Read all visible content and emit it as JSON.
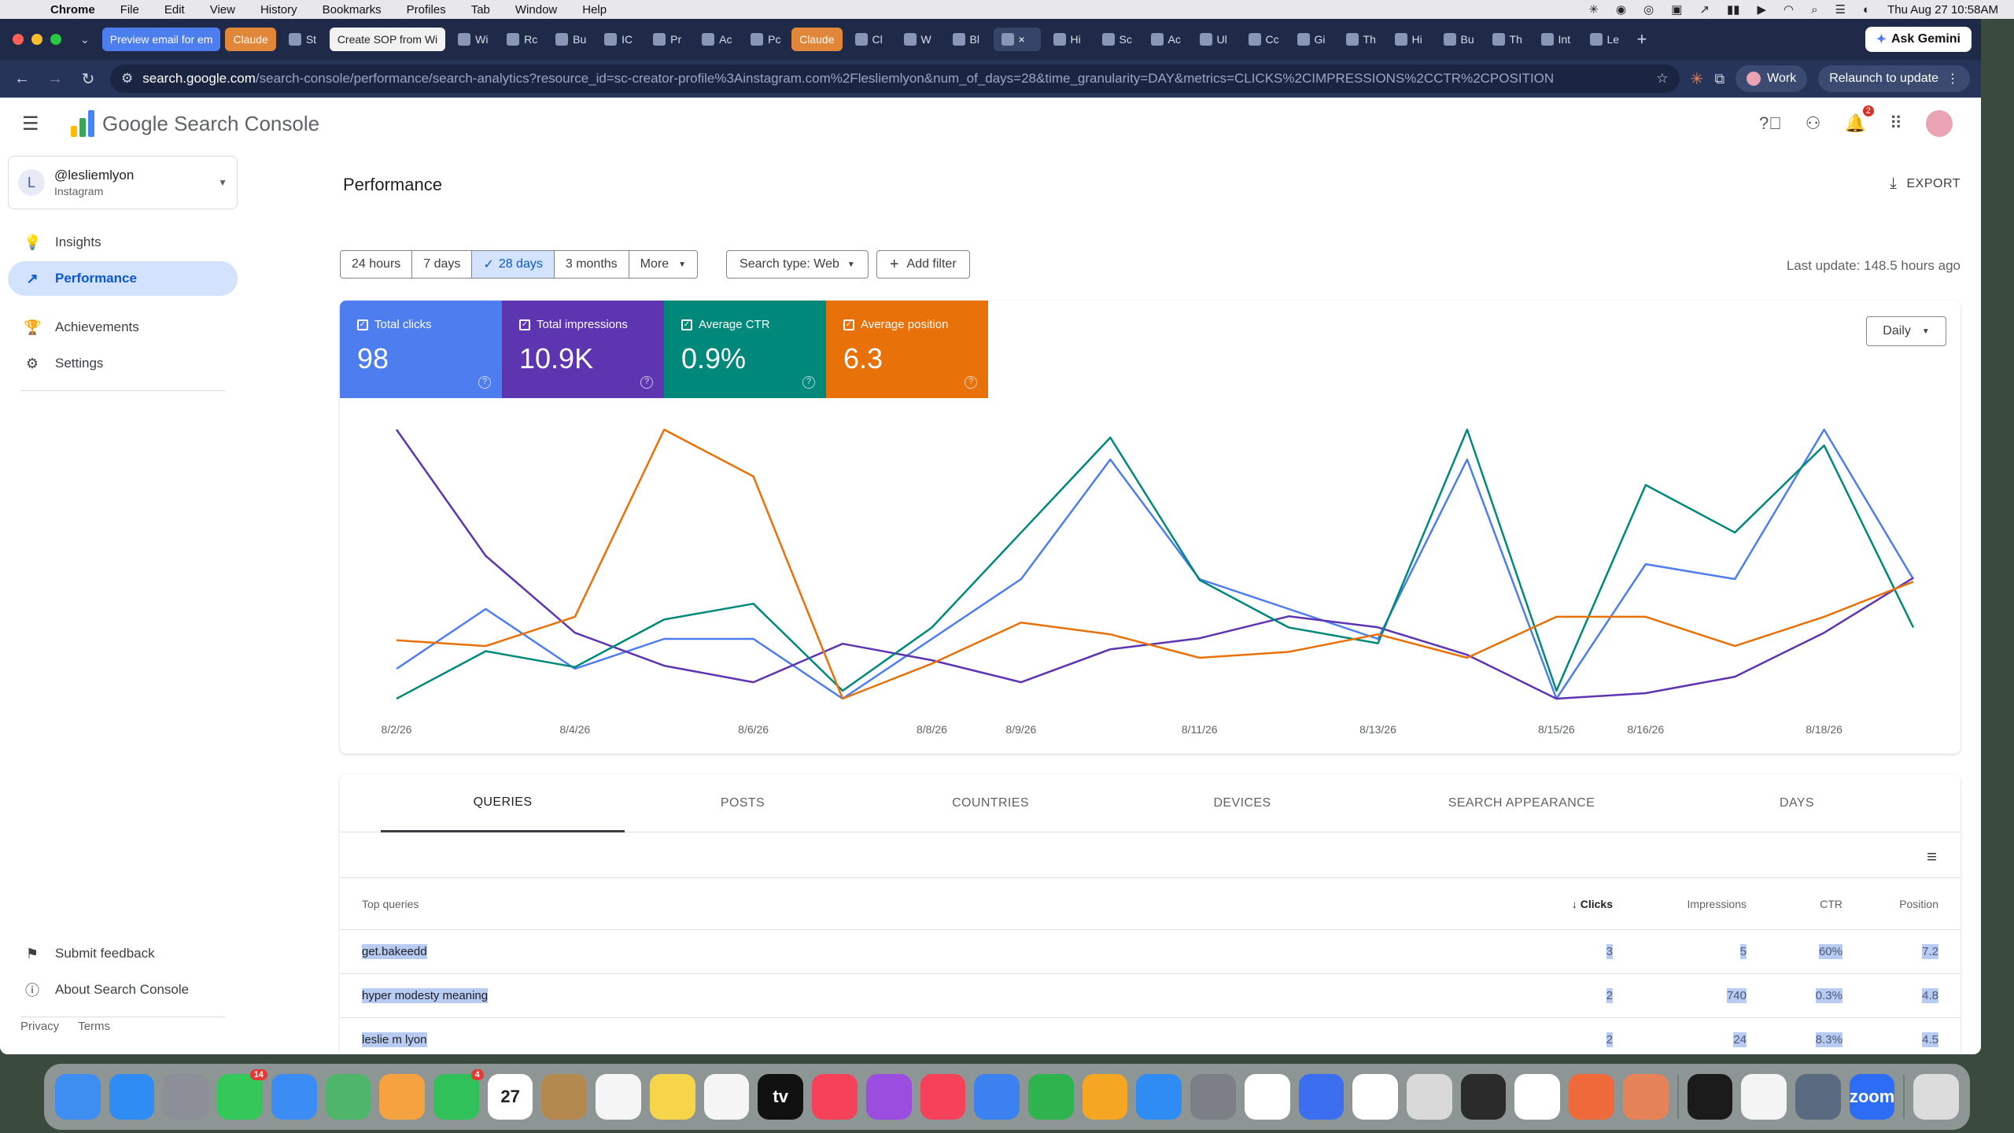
{
  "menubar": {
    "app": "Chrome",
    "items": [
      "File",
      "Edit",
      "View",
      "History",
      "Bookmarks",
      "Profiles",
      "Tab",
      "Window",
      "Help"
    ],
    "datetime": "Thu Aug 27  10:58AM"
  },
  "browser": {
    "tabs": [
      {
        "label": "Preview email for em",
        "style": "chip-blue"
      },
      {
        "label": "Claude",
        "style": "chip-orange"
      },
      {
        "label": "St",
        "style": "compact"
      },
      {
        "label": "Create SOP from Wi",
        "style": "chip-white"
      },
      {
        "label": "Wi",
        "style": "compact"
      },
      {
        "label": "Rc",
        "style": "compact"
      },
      {
        "label": "Bu",
        "style": "compact"
      },
      {
        "label": "IC",
        "style": "compact"
      },
      {
        "label": "Pr",
        "style": "compact"
      },
      {
        "label": "Ac",
        "style": "compact"
      },
      {
        "label": "Pc",
        "style": "compact"
      },
      {
        "label": "Claude",
        "style": "chip-orange"
      },
      {
        "label": "Cl",
        "style": "compact"
      },
      {
        "label": "W",
        "style": "compact"
      },
      {
        "label": "Bl",
        "style": "compact"
      },
      {
        "label": "×",
        "style": "active"
      },
      {
        "label": "Hi",
        "style": "compact"
      },
      {
        "label": "Sc",
        "style": "compact"
      },
      {
        "label": "Ac",
        "style": "compact"
      },
      {
        "label": "Ul",
        "style": "compact"
      },
      {
        "label": "Cc",
        "style": "compact"
      },
      {
        "label": "Gi",
        "style": "compact"
      },
      {
        "label": "Th",
        "style": "compact"
      },
      {
        "label": "Hi",
        "style": "compact"
      },
      {
        "label": "Bu",
        "style": "compact"
      },
      {
        "label": "Th",
        "style": "compact"
      },
      {
        "label": "Int",
        "style": "compact"
      },
      {
        "label": "Le",
        "style": "compact"
      }
    ],
    "new_tab": "+",
    "ask_gemini": "Ask Gemini",
    "url_host": "search.google.com",
    "url_path": "/search-console/performance/search-analytics?resource_id=sc-creator-profile%3Ainstagram.com%2Flesliemlyon&num_of_days=28&time_granularity=DAY&metrics=CLICKS%2CIMPRESSIONS%2CCTR%2CPOSITION",
    "profile_chip": "Work",
    "relaunch": "Relaunch to update"
  },
  "gsc": {
    "product_name": "Google Search Console",
    "property": {
      "initial": "L",
      "name": "@lesliemlyon",
      "type": "Instagram"
    },
    "nav": [
      {
        "label": "Insights",
        "icon": "lightbulb-icon",
        "glyph": "💡"
      },
      {
        "label": "Performance",
        "icon": "trending-up-icon",
        "glyph": "↗"
      },
      {
        "label": "Achievements",
        "icon": "trophy-icon",
        "glyph": "🏆"
      },
      {
        "label": "Settings",
        "icon": "gear-icon",
        "glyph": "⚙"
      }
    ],
    "bottom_nav": [
      {
        "label": "Submit feedback",
        "icon": "feedback-icon",
        "glyph": "⚑"
      },
      {
        "label": "About Search Console",
        "icon": "info-icon",
        "glyph": "ⓘ"
      }
    ],
    "footer": {
      "privacy": "Privacy",
      "terms": "Terms"
    },
    "notification_count": "2"
  },
  "performance": {
    "title": "Performance",
    "export": "EXPORT",
    "date_ranges": [
      "24 hours",
      "7 days",
      "28 days",
      "3 months",
      "More"
    ],
    "selected_range": "28 days",
    "search_type": "Search type: Web",
    "add_filter": "Add filter",
    "last_update": "Last update: 148.5 hours ago",
    "granularity": "Daily",
    "metrics": [
      {
        "label": "Total clicks",
        "value": "98",
        "color": "#4e7df0"
      },
      {
        "label": "Total impressions",
        "value": "10.9K",
        "color": "#5e35b1"
      },
      {
        "label": "Average CTR",
        "value": "0.9%",
        "color": "#00897b"
      },
      {
        "label": "Average position",
        "value": "6.3",
        "color": "#e8710a"
      }
    ]
  },
  "chart_data": {
    "type": "line",
    "x": [
      "8/2/26",
      "8/3/26",
      "8/4/26",
      "8/5/26",
      "8/6/26",
      "8/7/26",
      "8/8/26",
      "8/9/26",
      "8/10/26",
      "8/11/26",
      "8/12/26",
      "8/13/26",
      "8/14/26",
      "8/15/26",
      "8/16/26",
      "8/17/26",
      "8/18/26",
      "8/19/26"
    ],
    "x_tick_labels": [
      "8/2/26",
      "8/4/26",
      "8/6/26",
      "8/8/26",
      "8/9/26",
      "8/11/26",
      "8/13/26",
      "8/15/26",
      "8/16/26",
      "8/18/26"
    ],
    "x_tick_index": [
      0,
      2,
      4,
      6,
      7,
      9,
      11,
      13,
      14,
      16
    ],
    "series": [
      {
        "name": "Total clicks",
        "color": "#4e7df0",
        "values": [
          2,
          6,
          2,
          4,
          4,
          0,
          4,
          8,
          16,
          8,
          6,
          4,
          16,
          0,
          9,
          8,
          18,
          8
        ]
      },
      {
        "name": "Total impressions",
        "color": "#5e35b1",
        "values": [
          950,
          720,
          580,
          520,
          490,
          560,
          530,
          490,
          550,
          570,
          610,
          590,
          540,
          460,
          470,
          500,
          580,
          680
        ]
      },
      {
        "name": "Average CTR",
        "color": "#00897b",
        "values": [
          0.1,
          0.7,
          0.5,
          1.1,
          1.3,
          0.2,
          1.0,
          2.2,
          3.4,
          1.6,
          1.0,
          0.8,
          3.5,
          0.2,
          2.8,
          2.2,
          3.3,
          1.0
        ]
      },
      {
        "name": "Average position",
        "color": "#e8710a",
        "values": [
          5.9,
          5.8,
          6.3,
          9.5,
          8.7,
          4.9,
          5.5,
          6.2,
          6.0,
          5.6,
          5.7,
          6.0,
          5.6,
          6.3,
          6.3,
          5.8,
          6.3,
          6.9
        ]
      }
    ]
  },
  "table": {
    "tabs": [
      "QUERIES",
      "POSTS",
      "COUNTRIES",
      "DEVICES",
      "SEARCH APPEARANCE",
      "DAYS"
    ],
    "headers": {
      "query": "Top queries",
      "clicks": "Clicks",
      "impressions": "Impressions",
      "ctr": "CTR",
      "position": "Position"
    },
    "rows": [
      {
        "query": "get.bakeedd",
        "clicks": "3",
        "impressions": "5",
        "ctr": "60%",
        "position": "7.2"
      },
      {
        "query": "hyper modesty meaning",
        "clicks": "2",
        "impressions": "740",
        "ctr": "0.3%",
        "position": "4.8"
      },
      {
        "query": "leslie m lyon",
        "clicks": "2",
        "impressions": "24",
        "ctr": "8.3%",
        "position": "4.5"
      }
    ]
  },
  "dock": {
    "apps": [
      {
        "name": "finder",
        "color": "#3d8ef0"
      },
      {
        "name": "safari",
        "color": "#2f8cf2"
      },
      {
        "name": "launchpad",
        "color": "#8c8f98"
      },
      {
        "name": "messages",
        "color": "#34c759",
        "badge": "14"
      },
      {
        "name": "mail",
        "color": "#3b8df5"
      },
      {
        "name": "maps",
        "color": "#4fb56a"
      },
      {
        "name": "photos",
        "color": "#f4a340"
      },
      {
        "name": "facetime",
        "color": "#30c15a",
        "badge": "4"
      },
      {
        "name": "calendar",
        "color": "#ffffff",
        "label": "27"
      },
      {
        "name": "contacts",
        "color": "#b4894f"
      },
      {
        "name": "reminders",
        "color": "#f5f5f5"
      },
      {
        "name": "notes",
        "color": "#f7d54a"
      },
      {
        "name": "freeform",
        "color": "#f5f5f5"
      },
      {
        "name": "tv",
        "color": "#111111",
        "label": "tv"
      },
      {
        "name": "music",
        "color": "#f5425a"
      },
      {
        "name": "podcasts",
        "color": "#9b4de0"
      },
      {
        "name": "news",
        "color": "#f5425a"
      },
      {
        "name": "keynote",
        "color": "#3b82f0"
      },
      {
        "name": "numbers",
        "color": "#2fb34f"
      },
      {
        "name": "pages",
        "color": "#f5a623"
      },
      {
        "name": "app-store",
        "color": "#2f8cf2"
      },
      {
        "name": "system-settings",
        "color": "#7d7f86"
      },
      {
        "name": "bing",
        "color": "#ffffff"
      },
      {
        "name": "docs",
        "color": "#3b6ff0"
      },
      {
        "name": "slack",
        "color": "#ffffff"
      },
      {
        "name": "help",
        "color": "#d9d9d9"
      },
      {
        "name": "iphone-mirroring",
        "color": "#2b2b2b"
      },
      {
        "name": "chrome",
        "color": "#ffffff"
      },
      {
        "name": "spark",
        "color": "#ef6a3a"
      },
      {
        "name": "claude",
        "color": "#e58258"
      },
      {
        "name": "terminal",
        "color": "#1b1b1b"
      },
      {
        "name": "charts",
        "color": "#f4f4f4"
      },
      {
        "name": "preview",
        "color": "#5a6a80"
      },
      {
        "name": "zoom",
        "color": "#2d6cf5",
        "label": "zoom"
      },
      {
        "name": "trash",
        "color": "#dcdcdc"
      }
    ]
  }
}
